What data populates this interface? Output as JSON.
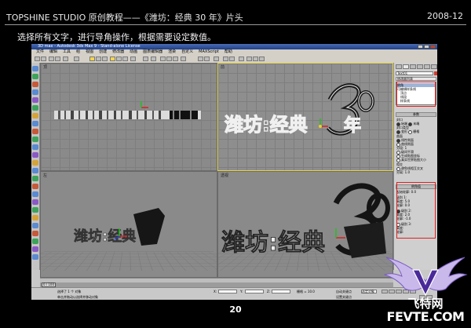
{
  "header": {
    "title": "TOPSHINE STUDIO 原创教程——《潍坊：经典 30 年》片头",
    "date": "2008-12"
  },
  "instruction": "选择所有文字，进行导角操作，根据需要设定数值。",
  "page_number": "20",
  "app": {
    "title": "3D max - Autodesk 3ds Max 9 - Stand-alone License",
    "menus": [
      "文件",
      "编辑",
      "工具",
      "组",
      "视图",
      "创建",
      "修改器",
      "动画",
      "图表编辑器",
      "渲染",
      "自定义",
      "MAXScript",
      "帮助"
    ],
    "viewports": {
      "top": "顶",
      "front": "前",
      "left": "左",
      "perspective": "透视"
    },
    "panel": {
      "name_field": "Text01",
      "modifier_list": "修改器列表",
      "stack_items": [
        "倒角",
        "可编辑样条线",
        "顶点",
        "线段",
        "样条线"
      ],
      "rollout_params": "参数",
      "rollout_values": "倒角值",
      "cap_label": "封口",
      "cap_start": "始端",
      "cap_end": "末端",
      "cap_type_label": "封口类型",
      "cap_morph": "变形",
      "cap_grid": "栅格",
      "surface_label": "曲面",
      "surface_linear": "线性侧面",
      "surface_curved": "曲线侧面",
      "segments_label": "分段:",
      "segments_value": "1",
      "smooth_sides": "级间平滑",
      "gen_map": "生成贴图坐标",
      "real_world": "真实世界贴图大小",
      "intersect_label": "相交",
      "avoid_lines": "避免线相互交叉",
      "separation_label": "分离:",
      "separation_value": "1.0",
      "start_outline": "起始轮廓:",
      "start_outline_value": "0.0",
      "level1": "级别 1:",
      "level2": "级别 2:",
      "level3": "级别 3:",
      "height": "高度:",
      "outline": "轮廓:",
      "l1_height": "5.0",
      "l1_outline": "0.0",
      "l2_height": "2.0",
      "l2_outline": "-1.0",
      "l3_height": "",
      "l3_outline": ""
    },
    "time_slider": "0 / 100",
    "status": {
      "selection": "选择了 1 个 对象",
      "prompt": "单击并拖动以选择并移动对象",
      "x_label": "X:",
      "y_label": "Y:",
      "z_label": "Z:",
      "grid": "栅格 = 10.0",
      "auto_key": "自动关键点",
      "set_key": "设置关键点",
      "selected": "选定对象"
    }
  },
  "logo": {
    "brand_cn": "飞特网",
    "brand_en": "FEVTE.COM"
  },
  "colors": {
    "page_bg": "#000000",
    "viewport_bg": "#8a8a8a",
    "highlight_box": "#e02020",
    "active_viewport": "#e6d44a"
  }
}
